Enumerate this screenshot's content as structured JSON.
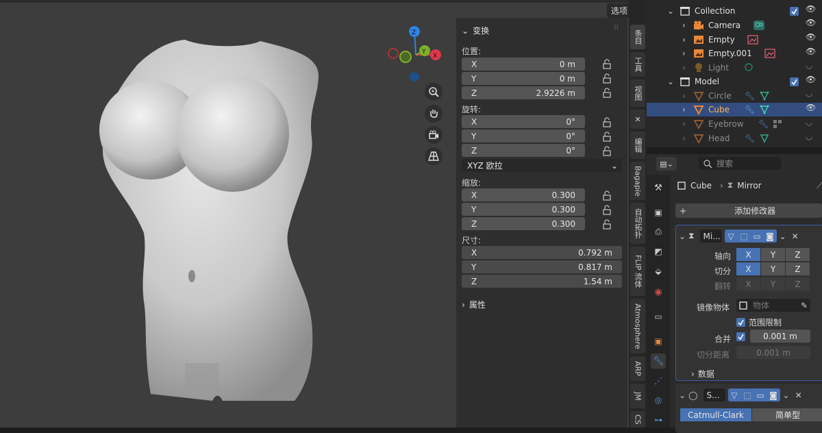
{
  "viewport": {
    "select_menu_label": "选项",
    "gizmo_axes": {
      "z": "Z",
      "y": "Y",
      "x": "X"
    }
  },
  "npanel": {
    "transform_title": "变换",
    "location_label": "位置:",
    "location": [
      {
        "axis": "X",
        "value": "0 m"
      },
      {
        "axis": "Y",
        "value": "0 m"
      },
      {
        "axis": "Z",
        "value": "2.9226 m"
      }
    ],
    "rotation_label": "旋转:",
    "rotation": [
      {
        "axis": "X",
        "value": "0°"
      },
      {
        "axis": "Y",
        "value": "0°"
      },
      {
        "axis": "Z",
        "value": "0°"
      }
    ],
    "rotation_mode": "XYZ 欧拉",
    "scale_label": "缩放:",
    "scale": [
      {
        "axis": "X",
        "value": "0.300"
      },
      {
        "axis": "Y",
        "value": "0.300"
      },
      {
        "axis": "Z",
        "value": "0.300"
      }
    ],
    "dimensions_label": "尺寸:",
    "dimensions": [
      {
        "axis": "X",
        "value": "0.792 m"
      },
      {
        "axis": "Y",
        "value": "0.817 m"
      },
      {
        "axis": "Z",
        "value": "1.54 m"
      }
    ],
    "properties_title": "属性"
  },
  "vtabs": [
    "条目",
    "工具",
    "视图",
    "✕",
    "编辑",
    "Bagapie",
    "自动拓扑",
    "FLIP 流体",
    "Atmosphere",
    "ARP",
    "JM",
    "CS"
  ],
  "outliner": {
    "rows": [
      {
        "name": "Collection",
        "indent": 1
      },
      {
        "name": "Camera",
        "indent": 2
      },
      {
        "name": "Empty",
        "indent": 2
      },
      {
        "name": "Empty.001",
        "indent": 2
      },
      {
        "name": "Light",
        "indent": 2
      },
      {
        "name": "Model",
        "indent": 1
      },
      {
        "name": "Circle",
        "indent": 2
      },
      {
        "name": "Cube",
        "indent": 2
      },
      {
        "name": "Eyebrow",
        "indent": 2
      },
      {
        "name": "Head",
        "indent": 2
      }
    ]
  },
  "properties": {
    "search_placeholder": "搜索",
    "object_name": "Cube",
    "modifier_name": "Mirror",
    "add_modifier_label": "添加修改器",
    "mirror": {
      "short_name": "Mi...",
      "axis_label": "轴向",
      "bisect_label": "切分",
      "flip_label": "翻转",
      "axes": [
        "X",
        "Y",
        "Z"
      ],
      "mirror_object_label": "镜像物体",
      "mirror_object_placeholder": "物体",
      "clipping_label": "范围限制",
      "merge_label": "合并",
      "merge_value": "0.001 m",
      "bisect_distance_label": "切分距离",
      "bisect_distance_value": "0.001 m",
      "data_label": "数据"
    },
    "subsurf": {
      "short_name": "S...",
      "catmull_label": "Catmull-Clark",
      "simple_label": "简单型"
    }
  },
  "colors": {
    "accent": "#4772b3",
    "object_orange": "#e8883a",
    "x_axis": "#e2384d",
    "y_axis": "#7fb12a",
    "z_axis": "#2f84e4"
  }
}
